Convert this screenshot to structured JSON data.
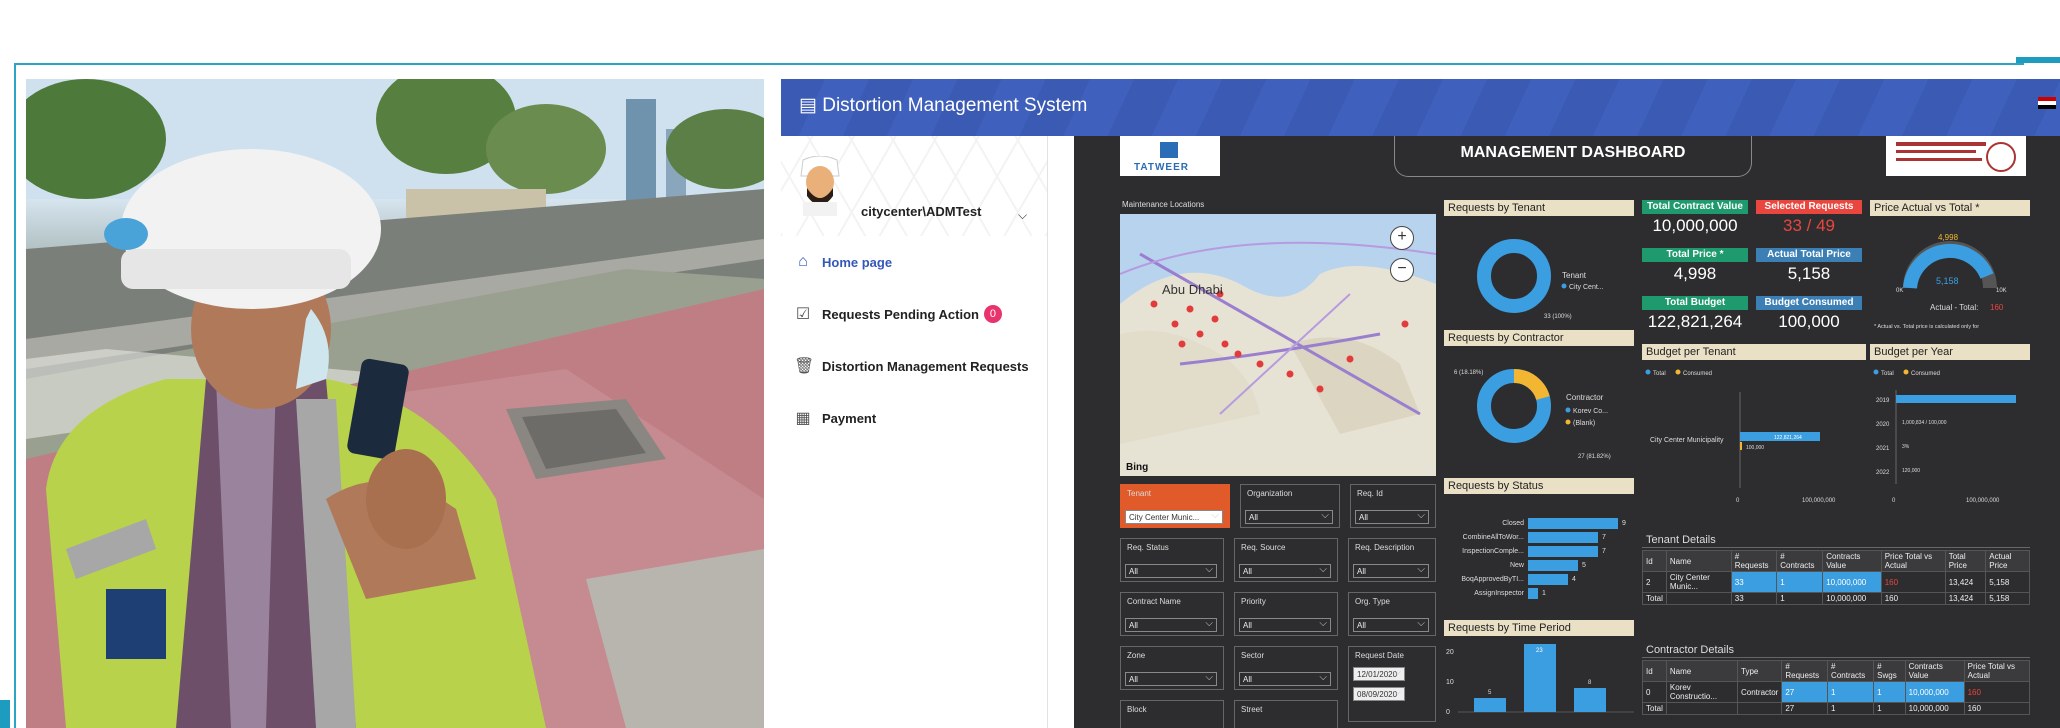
{
  "app": {
    "title": "Distortion Management System",
    "user": "citycenter\\ADMTest",
    "nav": [
      {
        "label": "Home page",
        "icon": "home-icon",
        "active": true
      },
      {
        "label": "Requests Pending Action",
        "icon": "clipboard-check-icon",
        "badge": "0"
      },
      {
        "label": "Distortion Management Requests",
        "icon": "trash-icon"
      },
      {
        "label": "Payment",
        "icon": "building-icon"
      }
    ]
  },
  "dashboard": {
    "header": "MANAGEMENT DASHBOARD",
    "logo_text": "TATWEER",
    "map": {
      "title": "Maintenance Locations",
      "city_label": "Abu Dhabi",
      "attribution": "Bing"
    },
    "tenant_panel": {
      "title": "Requests by Tenant",
      "legend_title": "Tenant",
      "legend_item": "City Cent...",
      "value": "33 (100%)"
    },
    "contractor_panel": {
      "title": "Requests by Contractor",
      "legend_title": "Contractor",
      "legend_items": [
        "Korev Co...",
        "(Blank)"
      ],
      "top_value": "6 (18.18%)",
      "bottom_value": "27 (81.82%)"
    },
    "status_panel": {
      "title": "Requests by Status",
      "rows": [
        {
          "label": "Closed",
          "value": "9"
        },
        {
          "label": "CombineAllToWor...",
          "value": "7"
        },
        {
          "label": "InspectionComple...",
          "value": "7"
        },
        {
          "label": "New",
          "value": "5"
        },
        {
          "label": "BoqApprovedByTI...",
          "value": "4"
        },
        {
          "label": "AssignInspector",
          "value": "1"
        }
      ]
    },
    "time_panel": {
      "title": "Requests by Time Period",
      "y_ticks": [
        "20",
        "10",
        "0"
      ],
      "bar_labels": [
        "5",
        "23",
        "8"
      ]
    },
    "kpis": [
      {
        "label": "Total Contract Value",
        "value": "10,000,000",
        "label_color": "#1f9a6e",
        "value_color": "#ffffff"
      },
      {
        "label": "Selected Requests",
        "value": "33 / 49",
        "label_color": "#e8463f",
        "value_color": "#e8463f"
      },
      {
        "label": "Total Price *",
        "value": "4,998",
        "label_color": "#1f9a6e",
        "value_color": "#ffffff"
      },
      {
        "label": "Actual Total Price",
        "value": "5,158",
        "label_color": "#3b7fb5",
        "value_color": "#ffffff"
      },
      {
        "label": "Total Budget",
        "value": "122,821,264",
        "label_color": "#1f9a6e",
        "value_color": "#ffffff"
      },
      {
        "label": "Budget Consumed",
        "value": "100,000",
        "label_color": "#3b7fb5",
        "value_color": "#ffffff"
      }
    ],
    "price_gauge": {
      "title": "Price Actual vs Total *",
      "top": "4,998",
      "center": "5,158",
      "left": "0K",
      "right": "10K",
      "footer_label": "Actual - Total:",
      "footer_value": "160",
      "note": "* Actual vs. Total price is calculated only for"
    },
    "budget_tenant": {
      "title": "Budget per Tenant",
      "legend": [
        "Total",
        "Consumed"
      ],
      "row_label": "City Center Municipality",
      "total_label": "122,821,264",
      "consumed_label": "100,000",
      "axis": [
        "0",
        "100,000,000"
      ]
    },
    "budget_year": {
      "title": "Budget per Year",
      "legend": [
        "Total",
        "Consumed"
      ],
      "years": [
        "2019",
        "2020",
        "2021",
        "2022"
      ],
      "values": [
        "",
        "1,000,834 / 100,000",
        "3%",
        "120,000"
      ],
      "axis": [
        "0",
        "100,000,000"
      ]
    },
    "filters": [
      {
        "label": "Tenant",
        "value": "City Center Munic..."
      },
      {
        "label": "Organization",
        "value": "All"
      },
      {
        "label": "Req. Id",
        "value": "All"
      },
      {
        "label": "Req. Status",
        "value": "All"
      },
      {
        "label": "Req. Source",
        "value": "All"
      },
      {
        "label": "Req. Description",
        "value": "All"
      },
      {
        "label": "Contract Name",
        "value": "All"
      },
      {
        "label": "Priority",
        "value": "All"
      },
      {
        "label": "Org. Type",
        "value": "All"
      },
      {
        "label": "Zone",
        "value": "All"
      },
      {
        "label": "Sector",
        "value": "All"
      },
      {
        "label": "Request Date",
        "value": "12/01/2020"
      },
      {
        "label": "Block",
        "value": ""
      },
      {
        "label": "Street",
        "value": ""
      }
    ],
    "request_date_to": "08/09/2020",
    "tenant_details": {
      "title": "Tenant Details",
      "headers": [
        "Id",
        "Name",
        "# Requests",
        "# Contracts",
        "Contracts Value",
        "Price Total vs Actual",
        "Total Price",
        "Actual Price"
      ],
      "rows": [
        [
          "2",
          "City Center Munic...",
          "33",
          "1",
          "10,000,000",
          "160",
          "13,424",
          "5,158"
        ],
        [
          "Total",
          "",
          "33",
          "1",
          "10,000,000",
          "160",
          "13,424",
          "5,158"
        ]
      ]
    },
    "contractor_details": {
      "title": "Contractor Details",
      "headers": [
        "Id",
        "Name",
        "Type",
        "# Requests",
        "# Contracts",
        "# Swgs",
        "Contracts Value",
        "Price Total vs Actual"
      ],
      "rows": [
        [
          "0",
          "Korev Constructio...",
          "Contractor",
          "27",
          "1",
          "1",
          "10,000,000",
          "160"
        ],
        [
          "Total",
          "",
          "",
          "27",
          "1",
          "1",
          "10,000,000",
          "160"
        ]
      ]
    }
  }
}
